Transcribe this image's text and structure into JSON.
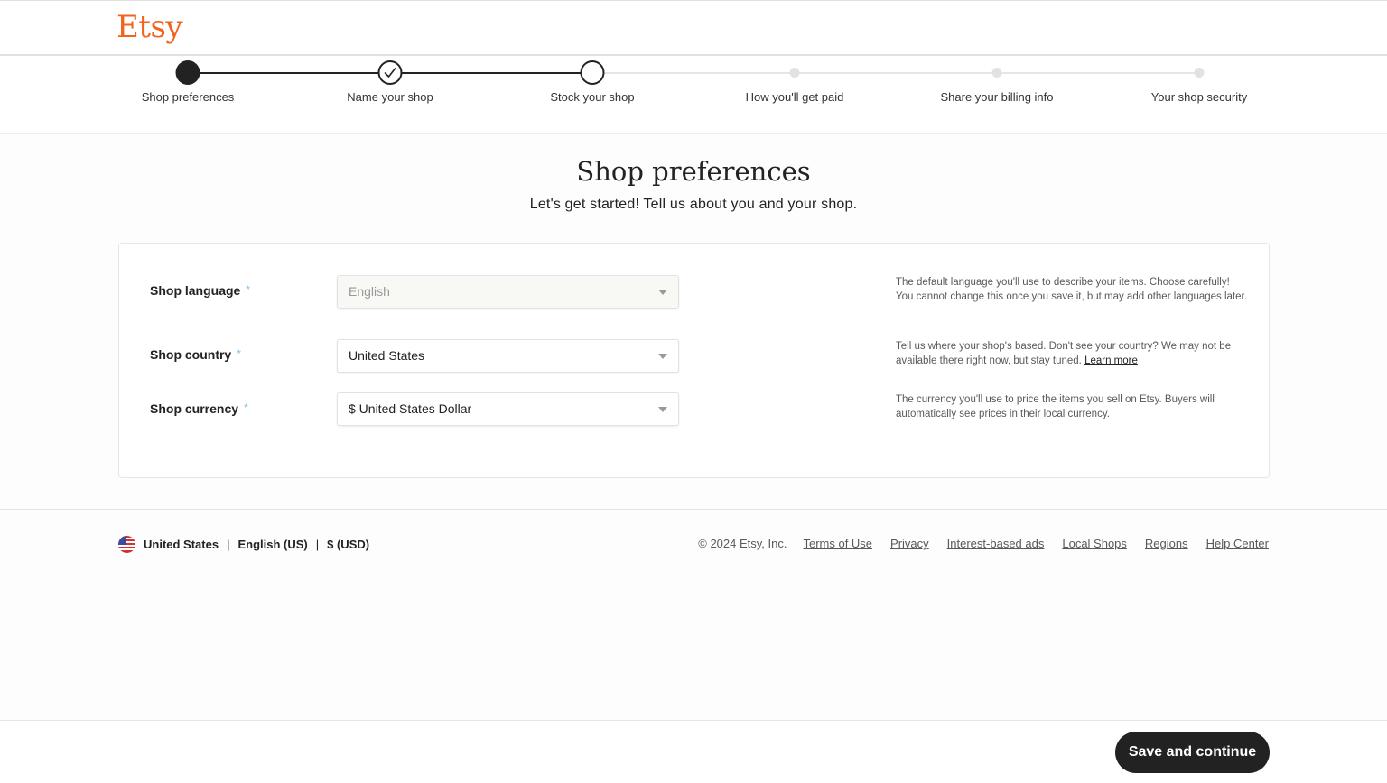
{
  "header": {
    "logo": "Etsy",
    "brand_color": "#f1641e"
  },
  "stepper": {
    "steps": [
      {
        "label": "Shop preferences",
        "state": "current"
      },
      {
        "label": "Name your shop",
        "state": "complete",
        "icon": "check-icon"
      },
      {
        "label": "Stock your shop",
        "state": "next"
      },
      {
        "label": "How you'll get paid",
        "state": "future"
      },
      {
        "label": "Share your billing info",
        "state": "future"
      },
      {
        "label": "Your shop security",
        "state": "future"
      }
    ]
  },
  "main": {
    "title": "Shop preferences",
    "subtitle": "Let's get started! Tell us about you and your shop."
  },
  "form": {
    "fields": [
      {
        "label": "Shop language",
        "required_marker": "*",
        "value": "English",
        "disabled": true,
        "help": "The default language you'll use to describe your items. Choose carefully! You cannot change this once you save it, but may add other languages later."
      },
      {
        "label": "Shop country",
        "required_marker": "*",
        "value": "United States",
        "disabled": false,
        "help": "Tell us where your shop's based. Don't see your country? We may not be available there right now, but stay tuned.",
        "help_link": "Learn more"
      },
      {
        "label": "Shop currency",
        "required_marker": "*",
        "value": "$ United States Dollar",
        "disabled": false,
        "help": "The currency you'll use to price the items you sell on Etsy. Buyers will automatically see prices in their local currency."
      }
    ]
  },
  "footer": {
    "locale": {
      "flag_icon": "us-flag-icon",
      "country": "United States",
      "separator": "|",
      "language": "English (US)",
      "currency": "$ (USD)"
    },
    "copyright": "© 2024 Etsy, Inc.",
    "links": [
      "Terms of Use",
      "Privacy",
      "Interest-based ads",
      "Local Shops",
      "Regions",
      "Help Center"
    ]
  },
  "actions": {
    "save_label": "Save and continue"
  }
}
